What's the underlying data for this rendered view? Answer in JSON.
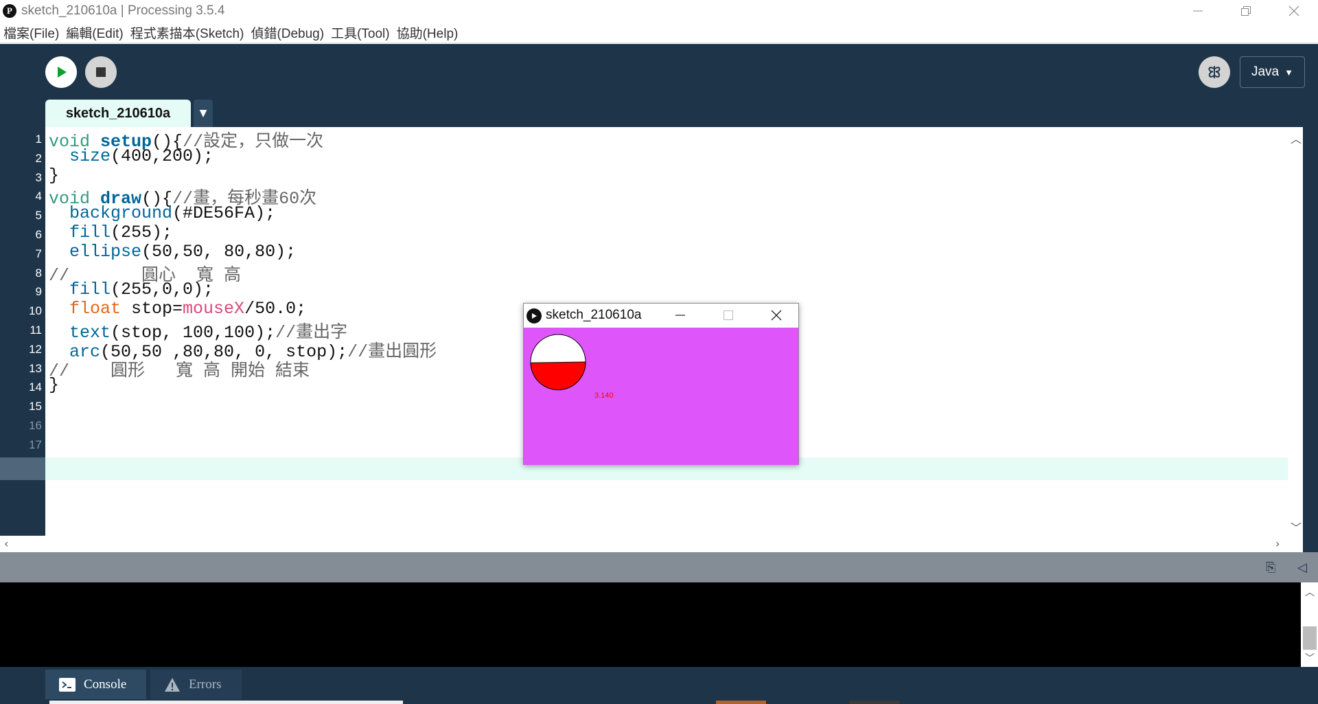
{
  "window": {
    "title": "sketch_210610a | Processing 3.5.4"
  },
  "menu": [
    "檔案(File)",
    "編輯(Edit)",
    "程式素描本(Sketch)",
    "偵錯(Debug)",
    "工具(Tool)",
    "協助(Help)"
  ],
  "toolbar": {
    "mode": "Java"
  },
  "tab": {
    "name": "sketch_210610a"
  },
  "editor": {
    "line_numbers": [
      "1",
      "2",
      "3",
      "4",
      "5",
      "6",
      "7",
      "8",
      "9",
      "10",
      "11",
      "12",
      "13",
      "14",
      "15",
      "16",
      "17"
    ],
    "lines": [
      [
        {
          "t": "void",
          "c": "kw"
        },
        {
          "t": " "
        },
        {
          "t": "setup",
          "c": "fn"
        },
        {
          "t": "(){"
        },
        {
          "t": "//設定，只做一次",
          "c": "cm"
        }
      ],
      [
        {
          "t": "  "
        },
        {
          "t": "size",
          "c": "bi"
        },
        {
          "t": "(400,200);"
        }
      ],
      [
        {
          "t": "}"
        }
      ],
      [
        {
          "t": "void",
          "c": "kw"
        },
        {
          "t": " "
        },
        {
          "t": "draw",
          "c": "fn"
        },
        {
          "t": "(){"
        },
        {
          "t": "//畫，每秒畫60次",
          "c": "cm"
        }
      ],
      [
        {
          "t": "  "
        },
        {
          "t": "background",
          "c": "bi"
        },
        {
          "t": "(#DE56FA);"
        }
      ],
      [
        {
          "t": "  "
        },
        {
          "t": "fill",
          "c": "bi"
        },
        {
          "t": "(255);"
        }
      ],
      [
        {
          "t": "  "
        },
        {
          "t": "ellipse",
          "c": "bi"
        },
        {
          "t": "(50,50, 80,80);"
        }
      ],
      [
        {
          "t": "//       圓心  寬 高",
          "c": "cm"
        }
      ],
      [
        {
          "t": "  "
        },
        {
          "t": "fill",
          "c": "bi"
        },
        {
          "t": "(255,0,0);"
        }
      ],
      [
        {
          "t": "  "
        },
        {
          "t": "float",
          "c": "fl"
        },
        {
          "t": " stop="
        },
        {
          "t": "mouseX",
          "c": "mv"
        },
        {
          "t": "/50.0;"
        }
      ],
      [
        {
          "t": "  "
        },
        {
          "t": "text",
          "c": "bi"
        },
        {
          "t": "(stop, 100,100);"
        },
        {
          "t": "//畫出字",
          "c": "cm"
        }
      ],
      [
        {
          "t": "  "
        },
        {
          "t": "arc",
          "c": "bi"
        },
        {
          "t": "(50,50 ,80,80, 0, stop);"
        },
        {
          "t": "//畫出圓形",
          "c": "cm"
        }
      ],
      [
        {
          "t": "//    圓形   寬 高 開始 結束",
          "c": "cm"
        }
      ],
      [
        {
          "t": "}"
        }
      ],
      [],
      [],
      []
    ]
  },
  "console_tabs": {
    "console": "Console",
    "errors": "Errors"
  },
  "sketch_window": {
    "title": "sketch_210610a",
    "output_text": "3.140"
  },
  "colors": {
    "dark": "#1d3449",
    "canvas": "#DE56FA",
    "current_line": "#e5fbf6"
  }
}
